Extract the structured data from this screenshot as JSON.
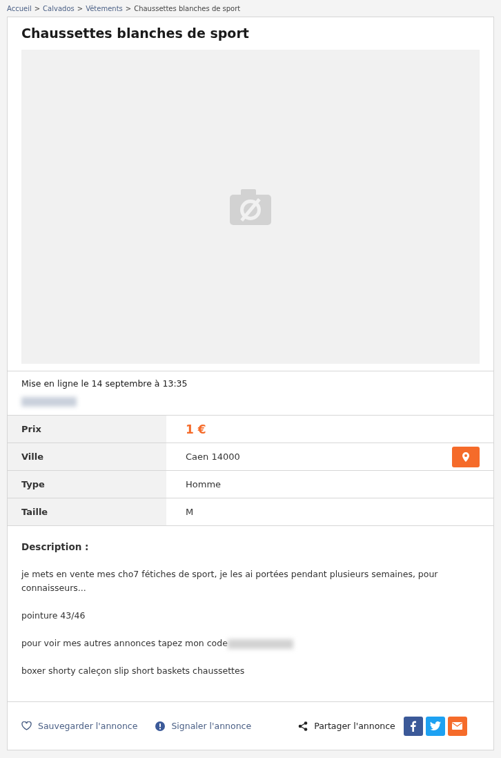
{
  "breadcrumb": {
    "separator": ">",
    "items": [
      {
        "label": "Accueil",
        "link": true
      },
      {
        "label": "Calvados",
        "link": true
      },
      {
        "label": "Vêtements",
        "link": true
      },
      {
        "label": "Chaussettes blanches de sport",
        "link": false
      }
    ]
  },
  "ad": {
    "title": "Chaussettes blanches de sport",
    "photo": {
      "kind": "placeholder"
    },
    "posted": "Mise en ligne le 14 septembre à 13:35"
  },
  "details": [
    {
      "label": "Prix",
      "value": "1 €",
      "kind": "price"
    },
    {
      "label": "Ville",
      "value": "Caen 14000",
      "kind": "location"
    },
    {
      "label": "Type",
      "value": "Homme",
      "kind": "text"
    },
    {
      "label": "Taille",
      "value": "M",
      "kind": "text"
    }
  ],
  "description": {
    "heading": "Description :",
    "paragraphs": [
      "je mets en vente mes cho7 fétiches de sport, je les ai portées pendant plusieurs semaines, pour connaisseurs...",
      "pointure 43/46",
      "pour voir mes autres annonces tapez mon code",
      "boxer shorty caleçon slip short baskets chaussettes"
    ]
  },
  "actions": {
    "save": "Sauvegarder l'annonce",
    "report": "Signaler l'annonce",
    "share": "Partager l'annonce",
    "share_buttons": [
      {
        "kind": "facebook"
      },
      {
        "kind": "twitter"
      },
      {
        "kind": "email"
      }
    ]
  }
}
